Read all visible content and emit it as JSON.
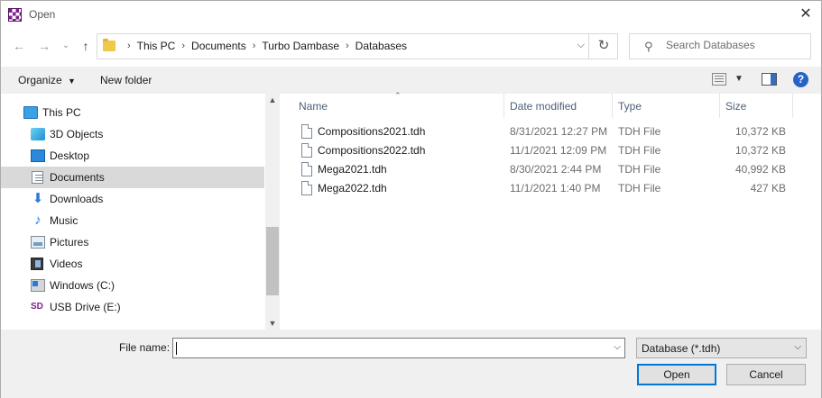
{
  "window": {
    "title": "Open"
  },
  "address": {
    "crumbs": [
      "This PC",
      "Documents",
      "Turbo Dambase",
      "Databases"
    ]
  },
  "search": {
    "placeholder": "Search Databases"
  },
  "toolbar": {
    "organize": "Organize",
    "new_folder": "New folder"
  },
  "nav": {
    "items": [
      {
        "label": "This PC",
        "icon": "computer-icon"
      },
      {
        "label": "3D Objects",
        "icon": "3d-objects-icon"
      },
      {
        "label": "Desktop",
        "icon": "desktop-icon"
      },
      {
        "label": "Documents",
        "icon": "documents-icon",
        "selected": true
      },
      {
        "label": "Downloads",
        "icon": "downloads-icon"
      },
      {
        "label": "Music",
        "icon": "music-icon"
      },
      {
        "label": "Pictures",
        "icon": "pictures-icon"
      },
      {
        "label": "Videos",
        "icon": "videos-icon"
      },
      {
        "label": "Windows (C:)",
        "icon": "drive-icon"
      },
      {
        "label": "USB Drive (E:)",
        "icon": "usb-drive-icon"
      }
    ]
  },
  "columns": {
    "name": "Name",
    "date": "Date modified",
    "type": "Type",
    "size": "Size"
  },
  "files": [
    {
      "name": "Compositions2021.tdh",
      "date": "8/31/2021 12:27 PM",
      "type": "TDH File",
      "size": "10,372 KB"
    },
    {
      "name": "Compositions2022.tdh",
      "date": "11/1/2021 12:09 PM",
      "type": "TDH File",
      "size": "10,372 KB"
    },
    {
      "name": "Mega2021.tdh",
      "date": "8/30/2021 2:44 PM",
      "type": "TDH File",
      "size": "40,992 KB"
    },
    {
      "name": "Mega2022.tdh",
      "date": "11/1/2021 1:40 PM",
      "type": "TDH File",
      "size": "427 KB"
    }
  ],
  "bottom": {
    "file_name_label": "File name:",
    "file_name_value": "",
    "file_type": "Database (*.tdh)",
    "open_label": "Open",
    "cancel_label": "Cancel"
  },
  "colors": {
    "accent": "#0078d7",
    "selection": "#d9d9d9",
    "folder": "#f0c84a"
  }
}
